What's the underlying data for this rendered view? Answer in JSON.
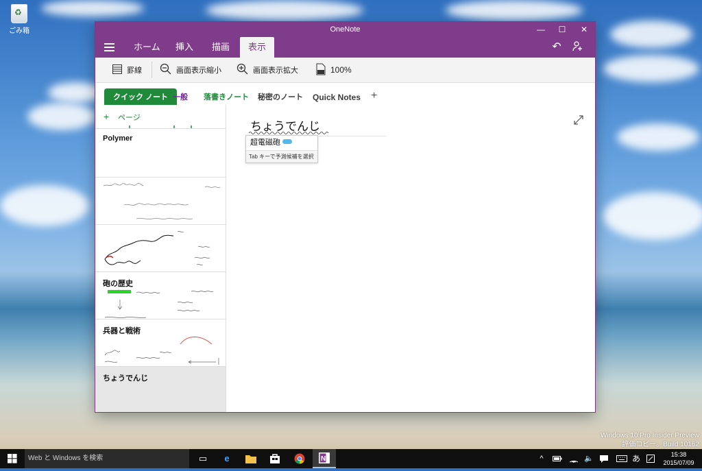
{
  "desktop": {
    "recycle_bin_label": "ごみ箱",
    "watermark_line1": "Windows 10 Pro Insider Preview",
    "watermark_line2": "評価コピー。Build 10162"
  },
  "window": {
    "title": "OneNote",
    "controls": {
      "minimize": "—",
      "maximize": "☐",
      "close": "✕"
    }
  },
  "ribbon": {
    "tabs": [
      {
        "label": "ホーム"
      },
      {
        "label": "挿入"
      },
      {
        "label": "描画"
      },
      {
        "label": "表示",
        "active": true
      }
    ],
    "accent_color": "#7f3c8a"
  },
  "toolbar": {
    "items": [
      {
        "label": "罫線",
        "icon": "ruled-lines-icon"
      },
      {
        "label": "画面表示縮小",
        "icon": "zoom-out-icon"
      },
      {
        "label": "画面表示拡大",
        "icon": "zoom-in-icon"
      },
      {
        "label": "100%",
        "icon": "page-100-icon"
      }
    ]
  },
  "sections": [
    {
      "label": "クイック ノート",
      "active": true,
      "color": "#1f8a3a"
    },
    {
      "label": "一般",
      "color": "#7b1fa2"
    },
    {
      "label": "落書きノート",
      "color": "#1f8a3a"
    },
    {
      "label": "秘密のノート",
      "color": "#3a3a3a"
    },
    {
      "label": "Quick Notes",
      "color": "#3a3a3a"
    },
    {
      "label": "+"
    }
  ],
  "pages": {
    "add_label": "ページ",
    "items": [
      {
        "title": "Polymer"
      },
      {
        "title": ""
      },
      {
        "title": ""
      },
      {
        "title": "砲の歴史"
      },
      {
        "title": "兵器と戦術"
      },
      {
        "title": "ちょうでんじ",
        "selected": true
      }
    ]
  },
  "note": {
    "title": "ちょうでんじ",
    "ime_candidate": "超電磁砲",
    "ime_hint": "Tab キーで予測候補を選択"
  },
  "taskbar": {
    "search_placeholder": "Web と Windows を検索",
    "ime_mode": "あ",
    "time": "15:38",
    "date": "2015/07/09"
  }
}
